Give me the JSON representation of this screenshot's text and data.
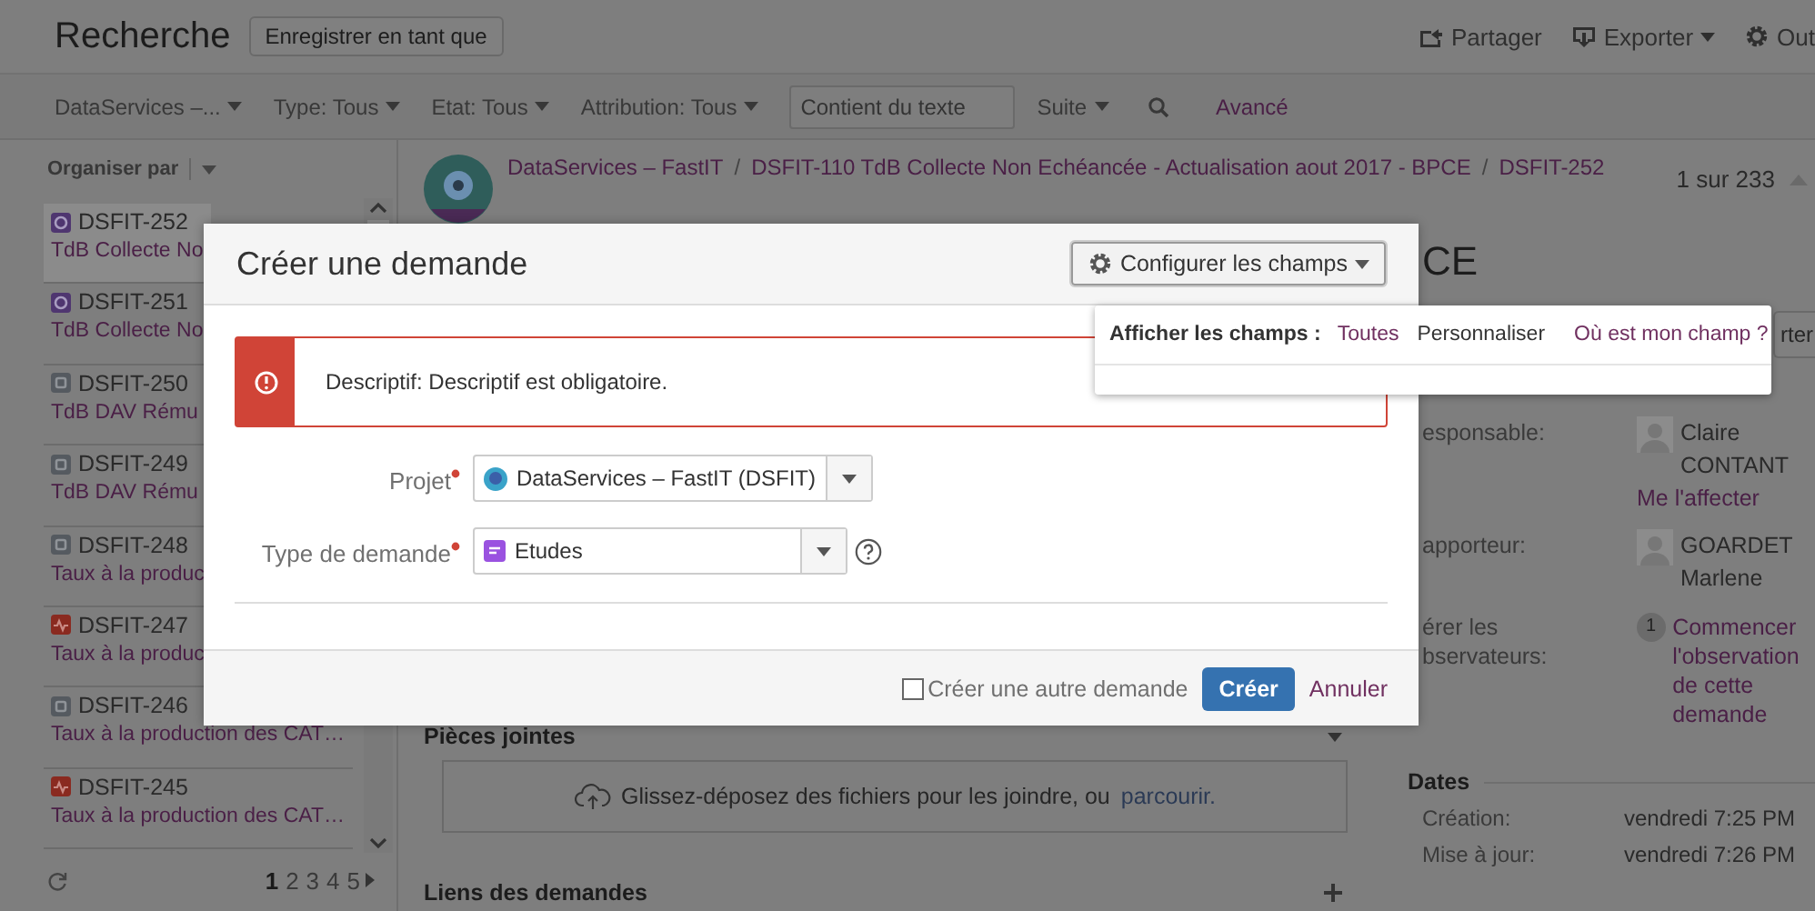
{
  "header": {
    "title": "Recherche",
    "save_button": "Enregistrer en tant que",
    "actions": [
      {
        "label": "Partager",
        "kind": "share",
        "dropdown": false
      },
      {
        "label": "Exporter",
        "kind": "export",
        "dropdown": true
      },
      {
        "label": "Out",
        "kind": "tools",
        "dropdown": false
      }
    ]
  },
  "filters": [
    {
      "kind": "dropdown",
      "label": "DataServices –..."
    },
    {
      "kind": "dropdown",
      "label": "Type: Tous"
    },
    {
      "kind": "dropdown",
      "label": "Etat: Tous"
    },
    {
      "kind": "dropdown",
      "label": "Attribution: Tous"
    },
    {
      "kind": "field",
      "placeholder": "Contient du texte"
    },
    {
      "kind": "dropdown",
      "label": "Suite"
    },
    {
      "kind": "search"
    },
    {
      "kind": "link",
      "label": "Avancé"
    }
  ],
  "sidebar": {
    "organize_label": "Organiser par",
    "issues": [
      {
        "key": "DSFIT-252",
        "summary": "TdB Collecte No",
        "kind": "story",
        "selected": true
      },
      {
        "key": "DSFIT-251",
        "summary": "TdB Collecte No",
        "kind": "story",
        "selected": false
      },
      {
        "key": "DSFIT-250",
        "summary": "TdB DAV Rému",
        "kind": "task",
        "selected": false
      },
      {
        "key": "DSFIT-249",
        "summary": "TdB DAV Rému",
        "kind": "task",
        "selected": false
      },
      {
        "key": "DSFIT-248",
        "summary": "Taux à la produc",
        "kind": "task",
        "selected": false
      },
      {
        "key": "DSFIT-247",
        "summary": "Taux à la produc",
        "kind": "bug",
        "selected": false
      },
      {
        "key": "DSFIT-246",
        "summary": "Taux à la production des CAT…",
        "kind": "task",
        "selected": false
      },
      {
        "key": "DSFIT-245",
        "summary": "Taux à la production des CAT…",
        "kind": "bug",
        "selected": false
      }
    ],
    "pages": [
      {
        "label": "1",
        "selected": true
      },
      {
        "label": "2",
        "selected": false
      },
      {
        "label": "3",
        "selected": false
      },
      {
        "label": "4",
        "selected": false
      },
      {
        "label": "5",
        "selected": false
      }
    ]
  },
  "issue": {
    "breadcrumbs": [
      {
        "kind": "link",
        "label": "DataServices – FastIT"
      },
      {
        "kind": "separator",
        "label": "/"
      },
      {
        "kind": "link",
        "label": "DSFIT-110 TdB Collecte Non Echéancée - Actualisation aout 2017 - BPCE"
      },
      {
        "kind": "separator",
        "label": "/"
      },
      {
        "kind": "link",
        "label": "DSFIT-252"
      }
    ],
    "counter": "1 sur 233",
    "title": "CE",
    "button": "rter",
    "attachments": {
      "title": "Pièces jointes",
      "drop_text": "Glissez-déposez des fichiers pour les joindre, ou",
      "browse_link": "parcourir."
    },
    "links_title": "Liens des demandes",
    "people": [
      {
        "label": "esponsable:",
        "name": "Claire CONTANT",
        "action": "Me l'affecter"
      },
      {
        "label": "apporteur:",
        "name": "GOARDET Marlene"
      }
    ],
    "watchers": {
      "label": "érer les bservateurs:",
      "count": "1",
      "action": "Commencer l'observation de cette demande"
    },
    "dates": {
      "title": "Dates",
      "rows": [
        {
          "label": "Création:",
          "value": "vendredi 7:25 PM"
        },
        {
          "label": "Mise à jour:",
          "value": "vendredi 7:26 PM"
        }
      ]
    }
  },
  "dialog": {
    "title": "Créer une demande",
    "configure_button": "Configurer les champs",
    "error": "Descriptif: Descriptif est obligatoire.",
    "fields": [
      {
        "kind": "project",
        "label": "Projet",
        "required": true,
        "value": "DataServices – FastIT (DSFIT)",
        "help": false
      },
      {
        "kind": "issuetype",
        "label": "Type de demande",
        "required": true,
        "value": "Etudes",
        "help": true
      }
    ],
    "footer": {
      "create_another": {
        "label": "Créer une autre demande",
        "checked": false
      },
      "submit": "Créer",
      "cancel": "Annuler"
    }
  },
  "popup": {
    "label": "Afficher les champs :",
    "options": [
      {
        "label": "Toutes",
        "selected": false
      },
      {
        "label": "Personnaliser",
        "selected": true
      }
    ],
    "help_link": "Où est mon champ ?"
  }
}
